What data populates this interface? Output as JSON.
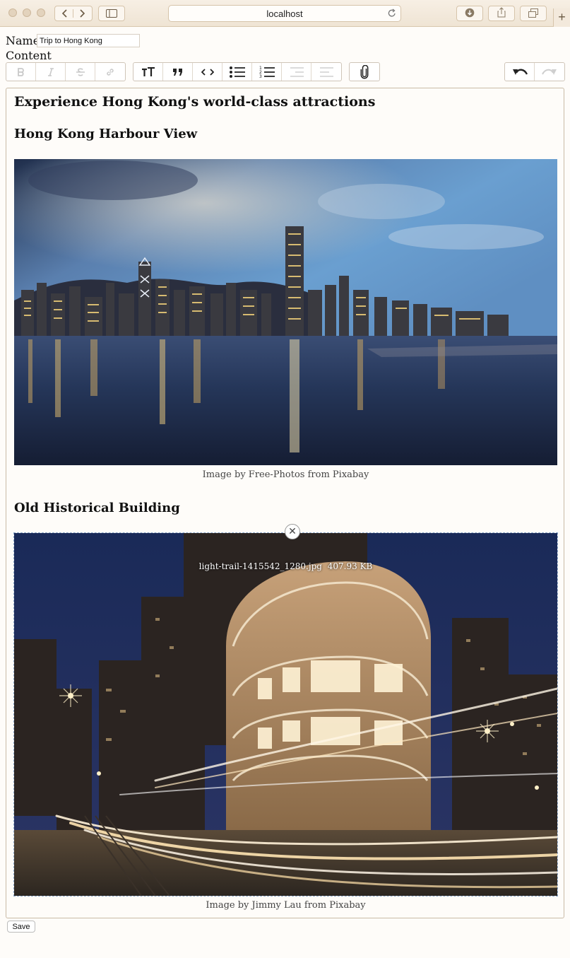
{
  "browser": {
    "url": "localhost"
  },
  "form": {
    "name_label": "Name",
    "name_value": "Trip to Hong Kong",
    "content_label": "Content",
    "save_label": "Save"
  },
  "toolbar": {
    "groups": [
      [
        "bold-icon",
        "italic-icon",
        "strikethrough-icon",
        "link-icon"
      ],
      [
        "heading-icon",
        "quote-icon",
        "code-icon",
        "bullet-list-icon",
        "numbered-list-icon",
        "decrease-indent-icon",
        "increase-indent-icon"
      ],
      [
        "attach-file-icon"
      ],
      [
        "undo-icon",
        "redo-icon"
      ]
    ]
  },
  "content": {
    "heading": "Experience Hong Kong's world-class attractions",
    "section1_title": "Hong Kong Harbour View",
    "image1_caption": "Image by Free-Photos from Pixabay",
    "section2_title": "Old Historical Building",
    "image2_filename": "light-trail-1415542_1280.jpg",
    "image2_filesize": "407.93 KB",
    "image2_caption": "Image by Jimmy Lau from Pixabay"
  },
  "colors": {
    "page_background": "#fefcf9",
    "chrome_background": "#f1e6d6",
    "attachment_border": "#8aa6c9"
  }
}
